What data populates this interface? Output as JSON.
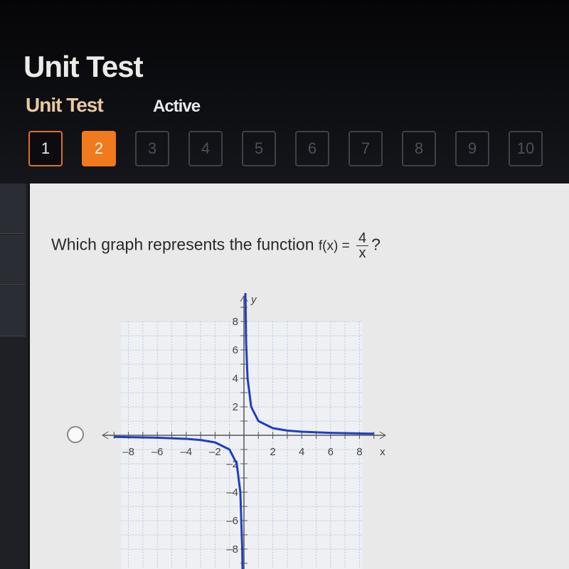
{
  "header": {
    "title": "Unit Test",
    "subtitle": "Unit Test",
    "status": "Active"
  },
  "question_nav": [
    {
      "label": "1",
      "state": "answered"
    },
    {
      "label": "2",
      "state": "current"
    },
    {
      "label": "3",
      "state": "unanswered"
    },
    {
      "label": "4",
      "state": "unanswered"
    },
    {
      "label": "5",
      "state": "unanswered"
    },
    {
      "label": "6",
      "state": "unanswered"
    },
    {
      "label": "7",
      "state": "unanswered"
    },
    {
      "label": "8",
      "state": "unanswered"
    },
    {
      "label": "9",
      "state": "unanswered"
    },
    {
      "label": "10",
      "state": "unanswered"
    }
  ],
  "colors": {
    "accent": "#f07a1c",
    "curve": "#1f3fbf",
    "grid": "#b9c9e0"
  },
  "question": {
    "prefix": "Which graph represents the function ",
    "func": "f(x) = ",
    "numerator": "4",
    "denominator": "x",
    "suffix": "?"
  },
  "chart_data": {
    "type": "line",
    "xlabel": "x",
    "ylabel": "y",
    "xlim": [
      -9,
      9
    ],
    "ylim": [
      -9,
      9
    ],
    "xticks": [
      "-8",
      "-6",
      "-4",
      "-2",
      "2",
      "4",
      "6",
      "8"
    ],
    "yticks": [
      "8",
      "6",
      "4",
      "2",
      "-2",
      "-4",
      "-6",
      "-8"
    ],
    "grid": true,
    "series": [
      {
        "points": [
          [
            -9,
            -0.11
          ],
          [
            -6,
            -0.17
          ],
          [
            -4,
            -0.25
          ],
          [
            -3,
            -0.33
          ],
          [
            -2,
            -0.5
          ],
          [
            -1,
            -1
          ],
          [
            -0.5,
            -2
          ],
          [
            -0.25,
            -4
          ],
          [
            -0.12,
            -8
          ],
          [
            -0.1,
            -10
          ]
        ]
      },
      {
        "points": [
          [
            0.1,
            10
          ],
          [
            0.15,
            6.5
          ],
          [
            0.25,
            4
          ],
          [
            0.5,
            2
          ],
          [
            1,
            1
          ],
          [
            2,
            0.5
          ],
          [
            3,
            0.33
          ],
          [
            4,
            0.25
          ],
          [
            6,
            0.17
          ],
          [
            9,
            0.11
          ]
        ]
      }
    ]
  }
}
